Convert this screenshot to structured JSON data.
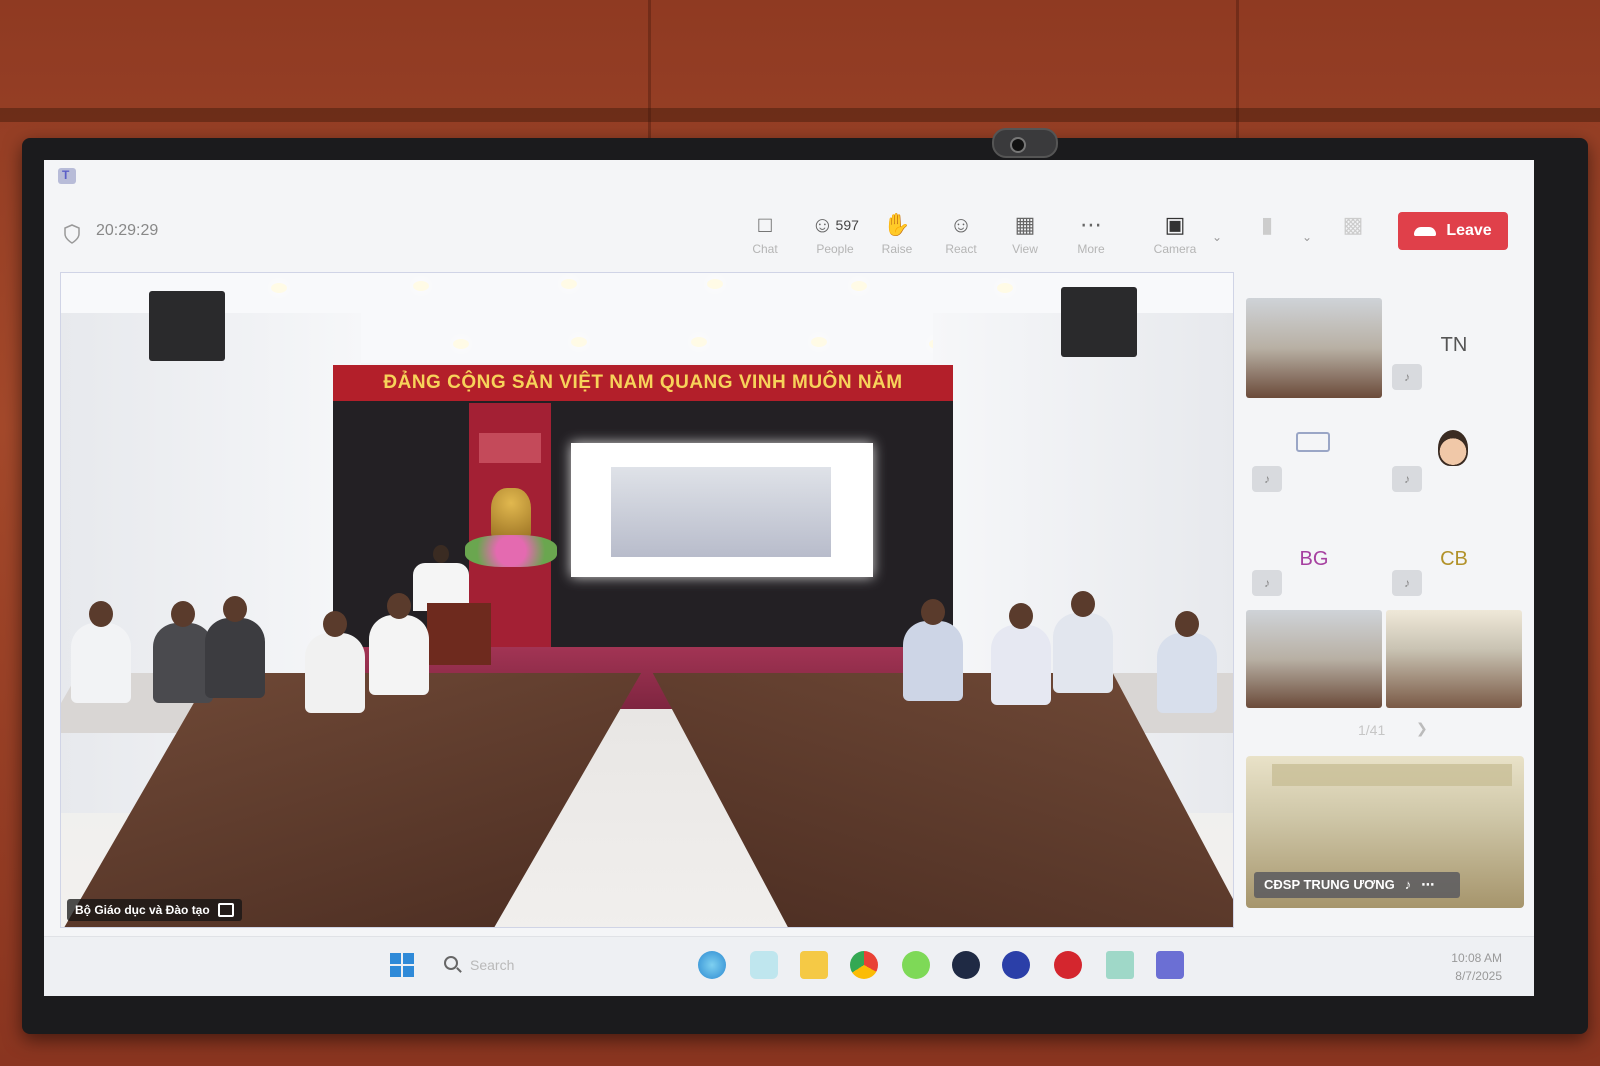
{
  "meeting": {
    "timer": "20:29:29",
    "toolbar": {
      "chat": "Chat",
      "people": "People",
      "people_count": "597",
      "raise": "Raise",
      "react": "React",
      "view": "View",
      "more": "More",
      "camera": "Camera",
      "leave": "Leave"
    },
    "main_video": {
      "banner_text": "ĐẢNG CỘNG SẢN VIỆT NAM QUANG VINH MUÔN NĂM",
      "name_tag": "Bộ Giáo dục và Đào tạo"
    },
    "participants": [
      {
        "initials": "TN"
      },
      {
        "initials": "BG"
      },
      {
        "initials": "CB"
      }
    ],
    "pager": "1/41",
    "self_view": {
      "name": "CĐSP TRUNG ƯƠNG"
    }
  },
  "taskbar": {
    "search_placeholder": "Search",
    "time": "10:08 AM",
    "date": "8/7/2025"
  },
  "colors": {
    "leave": "#e0404a",
    "banner": "#b31f2a",
    "banner_text": "#f7d35a"
  }
}
